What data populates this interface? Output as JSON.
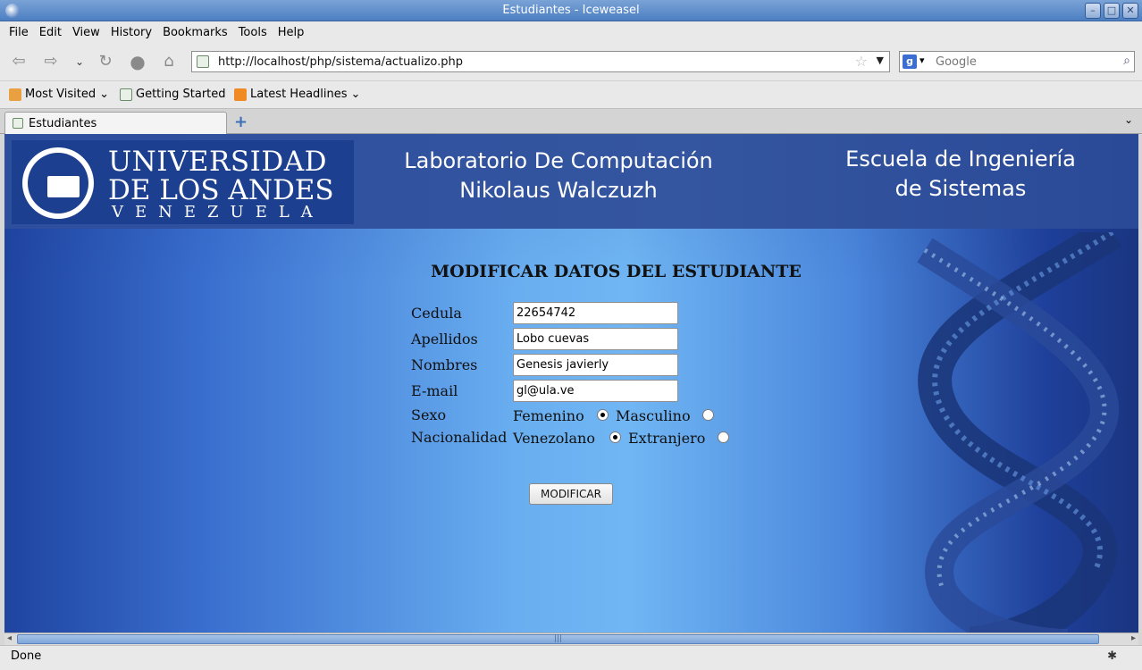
{
  "window": {
    "title": "Estudiantes - Iceweasel",
    "controls": [
      "minimize-button",
      "maximize-button",
      "close-button"
    ]
  },
  "menu": {
    "items": [
      {
        "label": "File",
        "accel": "F"
      },
      {
        "label": "Edit",
        "accel": "E"
      },
      {
        "label": "View",
        "accel": "V"
      },
      {
        "label": "History",
        "accel": "s"
      },
      {
        "label": "Bookmarks",
        "accel": "B"
      },
      {
        "label": "Tools",
        "accel": "T"
      },
      {
        "label": "Help",
        "accel": "H"
      }
    ]
  },
  "toolbar": {
    "url": "http://localhost/php/sistema/actualizo.php",
    "search_placeholder": "Google",
    "icons": [
      "back-icon",
      "forward-icon",
      "history-dropdown-icon",
      "reload-icon",
      "stop-icon",
      "home-icon",
      "bookmark-star-icon",
      "search-engine-icon",
      "magnifier-icon"
    ]
  },
  "bookmarks": {
    "items": [
      "Most Visited",
      "Getting Started",
      "Latest Headlines"
    ]
  },
  "tabs": {
    "items": [
      {
        "label": "Estudiantes",
        "active": true
      }
    ]
  },
  "page": {
    "logo": {
      "line1": "UNIVERSIDAD",
      "line2": "DE LOS ANDES",
      "line3": "VENEZUELA"
    },
    "lab_title": {
      "line1": "Laboratorio De Computación",
      "line2": "Nikolaus Walczuzh"
    },
    "school_title": {
      "line1": "Escuela de Ingeniería",
      "line2": "de Sistemas"
    },
    "form": {
      "title": "MODIFICAR DATOS DEL ESTUDIANTE",
      "fields": {
        "cedula": {
          "label": "Cedula",
          "value": "22654742"
        },
        "apellidos": {
          "label": "Apellidos",
          "value": "Lobo cuevas"
        },
        "nombres": {
          "label": "Nombres",
          "value": "Genesis javierly"
        },
        "email": {
          "label": "E-mail",
          "value": "gl@ula.ve"
        }
      },
      "sexo": {
        "label": "Sexo",
        "options": [
          {
            "label": "Femenino",
            "selected": true
          },
          {
            "label": "Masculino",
            "selected": false
          }
        ]
      },
      "nacionalidad": {
        "label": "Nacionalidad",
        "options": [
          {
            "label": "Venezolano",
            "selected": true
          },
          {
            "label": "Extranjero",
            "selected": false
          }
        ]
      },
      "submit_label": "MODIFICAR"
    }
  },
  "status": {
    "text": "Done"
  },
  "colors": {
    "titlebar": "#4c7fc2",
    "header_bg": "#2d4f9e",
    "page_gradient_light": "#70b6f4",
    "page_gradient_dark": "#1f44a0"
  }
}
